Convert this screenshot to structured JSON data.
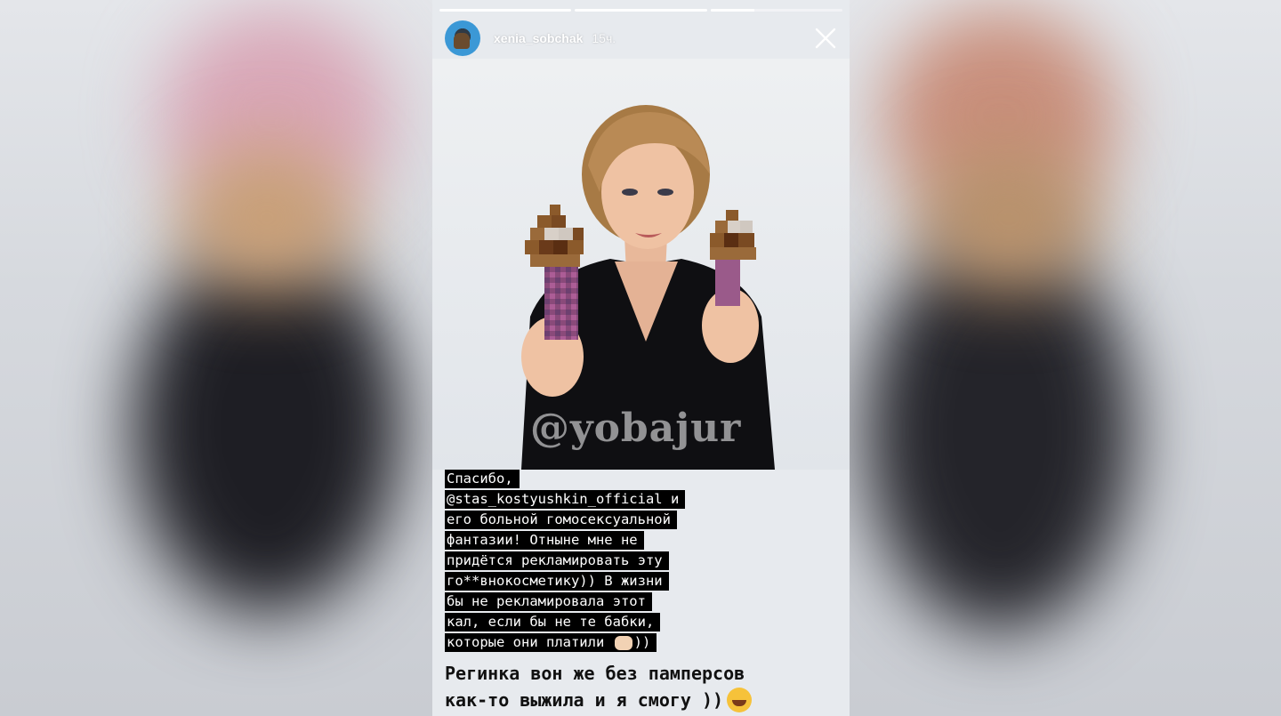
{
  "story": {
    "username": "xenia_sobchak",
    "timestamp": "15ч.",
    "progress": [
      1.0,
      1.0,
      0.33
    ],
    "watermark": "@yobajur",
    "caption_lines": [
      "Спасибо,",
      "@stas_kostyushkin_official и",
      "его больной гомосексуальной",
      "фантазии! Отныне мне не",
      "придётся рекламировать эту",
      "го**внокосметику)) В жизни",
      "бы не рекламировала этот",
      "кал, если бы не те бабки,",
      "которые они платили"
    ],
    "caption_end": "))",
    "subtitle_line1": "Регинка вон же без памперсов",
    "subtitle_line2": "как-то выжила и я смогу ))"
  },
  "icons": {
    "close": "close-icon",
    "avatar": "avatar",
    "hands": "praying-hands-emoji",
    "laugh": "rofl-emoji"
  },
  "colors": {
    "highlight": "#000000",
    "text_on_highlight": "#ffffff"
  }
}
